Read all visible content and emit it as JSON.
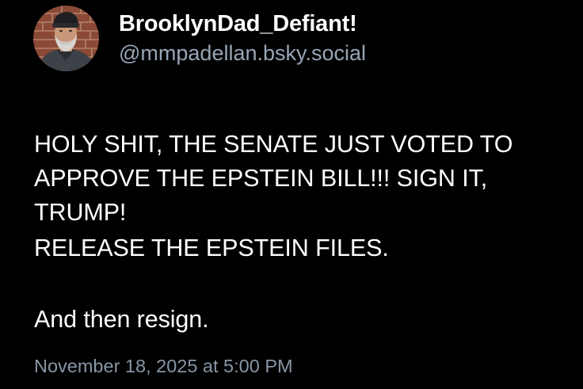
{
  "post": {
    "author": {
      "display_name": "BrooklynDad_Defiant!",
      "handle": "@mmpadellan.bsky.social"
    },
    "paragraphs": [
      "HOLY SHIT, THE SENATE JUST VOTED TO\nAPPROVE THE EPSTEIN BILL!!! SIGN IT,\nTRUMP!",
      "RELEASE THE EPSTEIN FILES.",
      "And then resign."
    ],
    "timestamp": "November 18, 2025 at 5:00 PM"
  },
  "colors": {
    "background": "#000000",
    "text": "#ffffff",
    "handle": "#97a6b6",
    "timestamp": "#8796a6"
  },
  "icons": {
    "avatar": "avatar-photo"
  }
}
